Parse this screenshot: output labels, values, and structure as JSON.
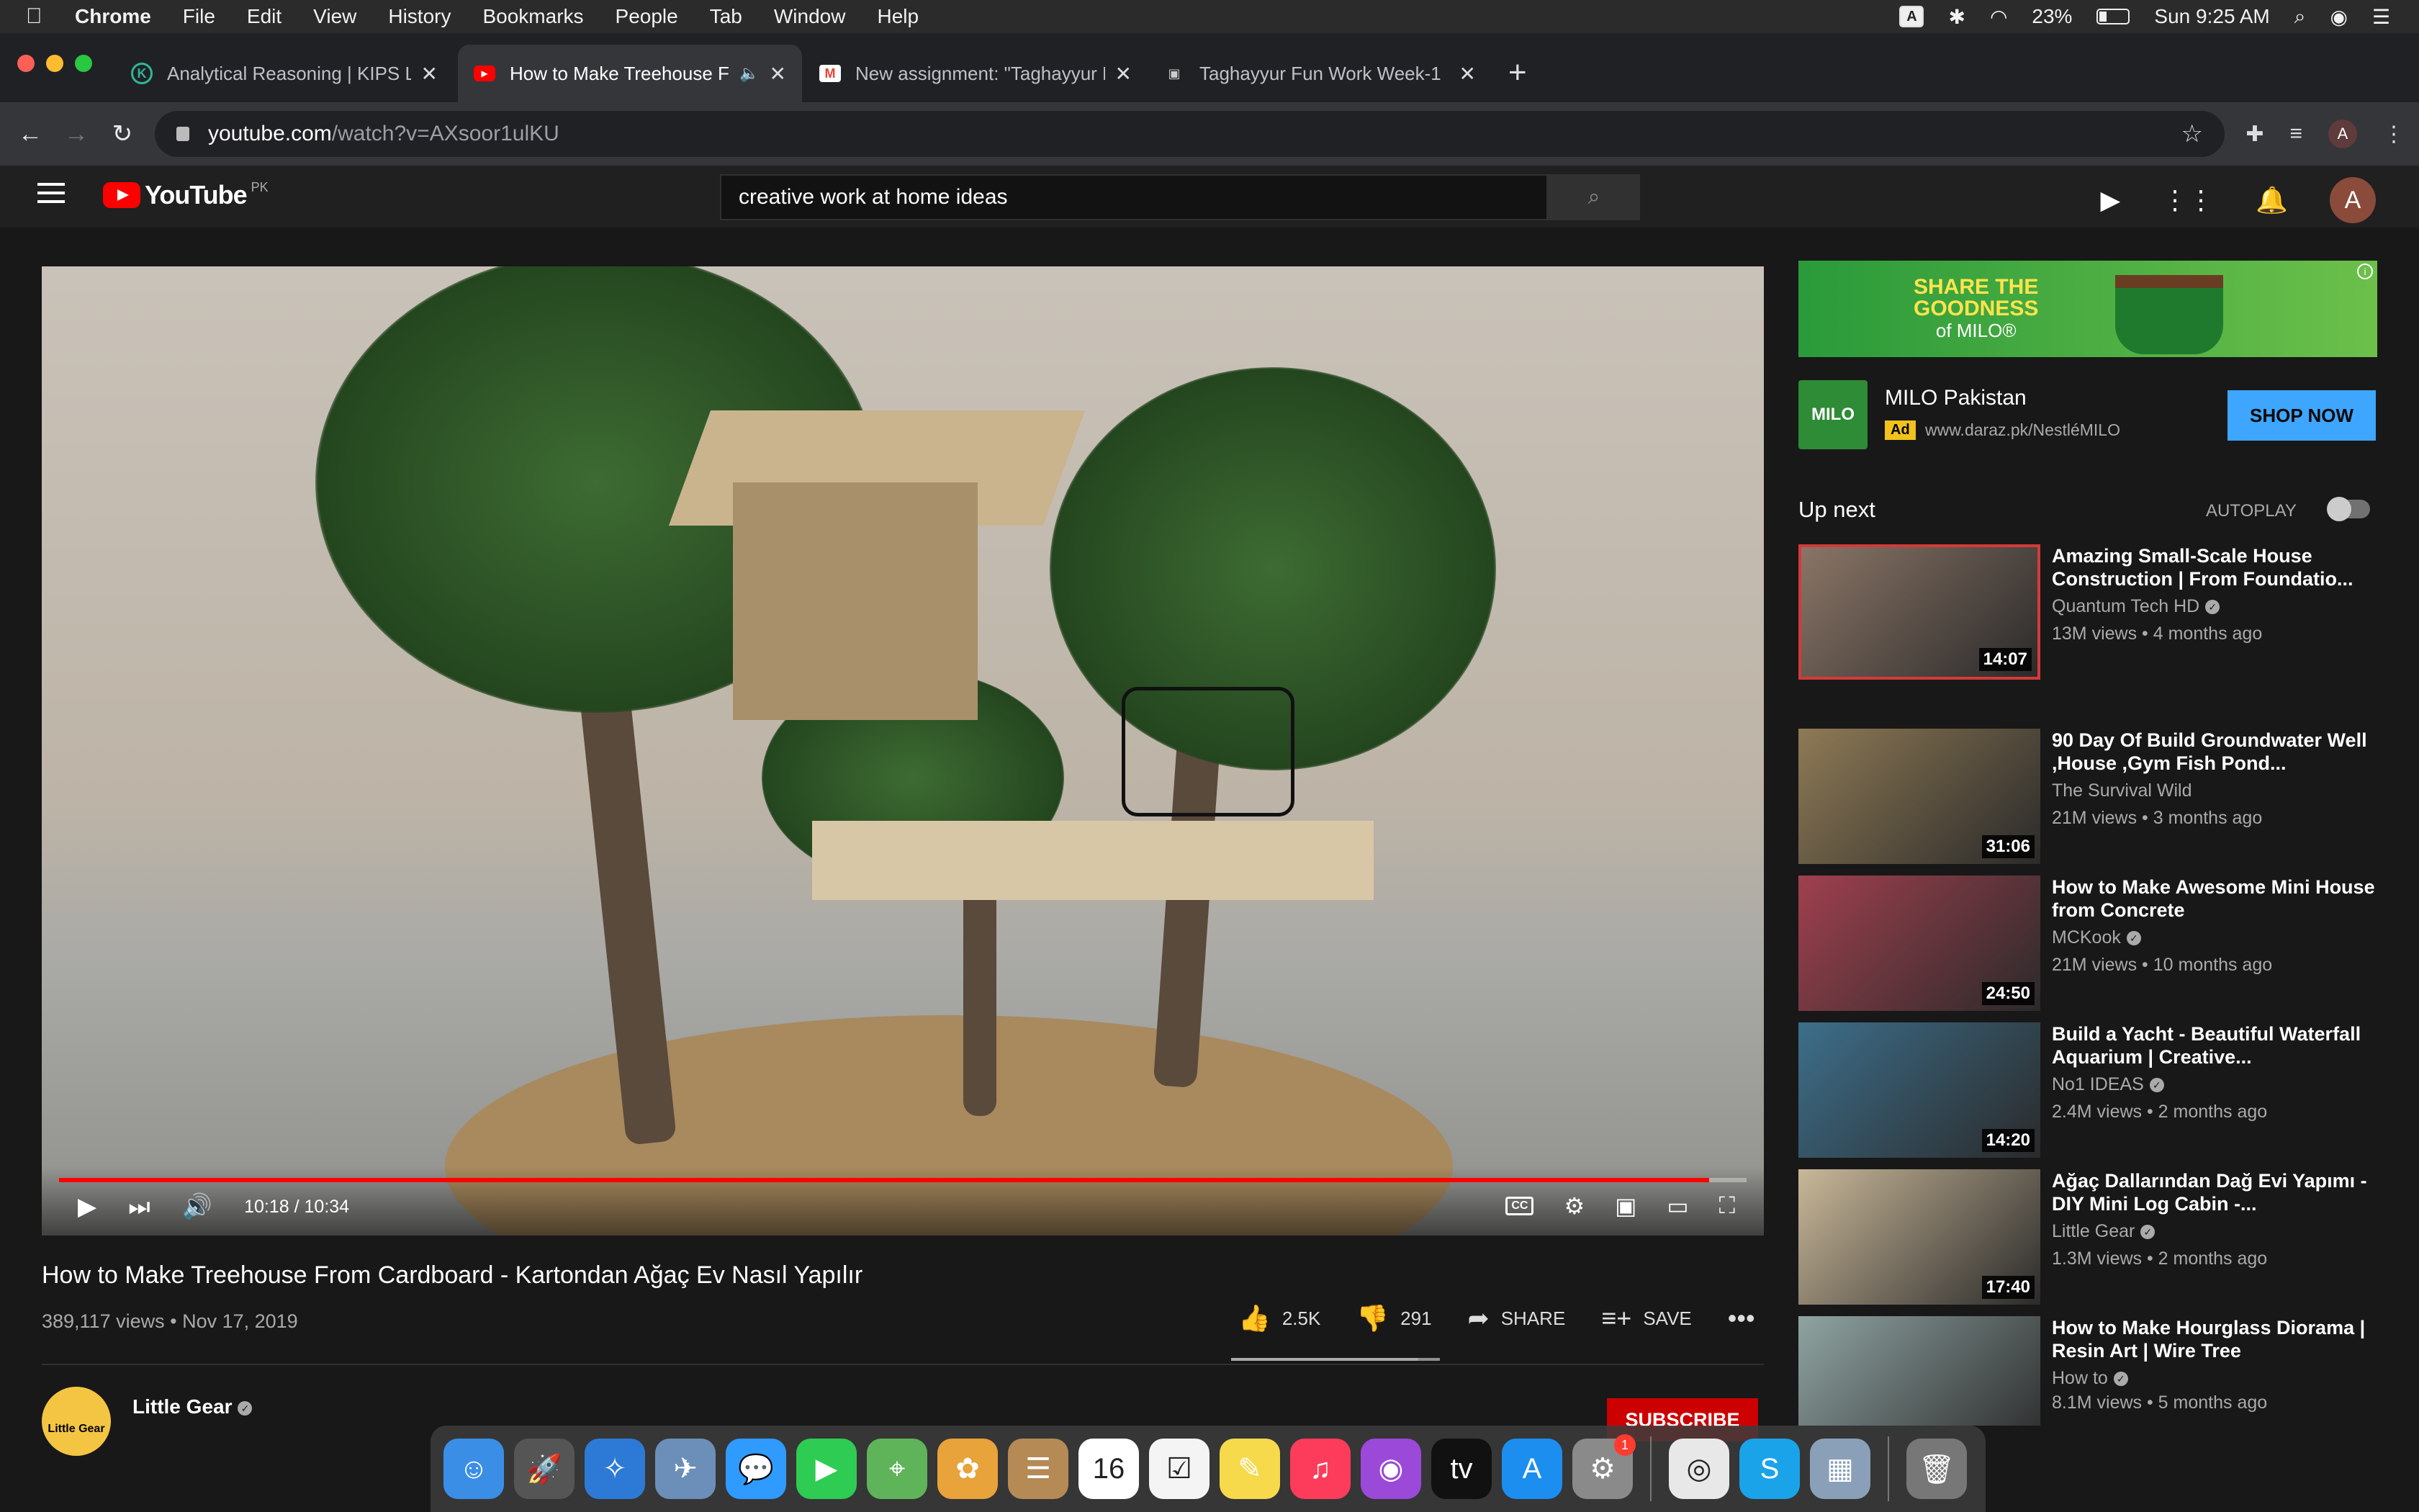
{
  "menubar": {
    "app": "Chrome",
    "items": [
      "File",
      "Edit",
      "View",
      "History",
      "Bookmarks",
      "People",
      "Tab",
      "Window",
      "Help"
    ],
    "input_source": "A",
    "battery": "23%",
    "clock": "Sun 9:25 AM"
  },
  "tabs": [
    {
      "title": "Analytical Reasoning | KIPS LM",
      "favicon": "K",
      "color": "#2fb59b"
    },
    {
      "title": "How to Make Treehouse Fr",
      "favicon": "▶",
      "color": "#ff0000"
    },
    {
      "title": "New assignment: \"Taghayyur F",
      "favicon": "M",
      "color": "#ea4335"
    },
    {
      "title": "Taghayyur Fun Work Week-1",
      "favicon": "▣",
      "color": "#888888"
    }
  ],
  "address": {
    "host": "youtube.com",
    "path": "/watch?v=AXsoor1ulKU"
  },
  "profile_initial": "A",
  "youtube": {
    "region": "PK",
    "search_query": "creative work at home ideas",
    "avatar_initial": "A"
  },
  "player": {
    "time": "10:18 / 10:34",
    "progress": 0.978
  },
  "video": {
    "title": "How to Make Treehouse From Cardboard - Kartondan Ağaç Ev Nasıl Yapılır",
    "meta": "389,117 views • Nov 17, 2019",
    "likes": "2.5K",
    "dislikes": "291",
    "share": "SHARE",
    "save": "SAVE",
    "like_ratio": 0.896
  },
  "channel": {
    "name": "Little Gear",
    "avatar_text": "Little Gear",
    "subscribe": "SUBSCRIBE"
  },
  "ad": {
    "banner_lines": [
      "SHARE THE",
      "GOODNESS",
      "of MILO®"
    ],
    "advertiser": "MILO Pakistan",
    "badge": "Ad",
    "url": "www.daraz.pk/NestléMILO",
    "cta": "SHOP NOW",
    "logo_text": "MILO"
  },
  "sidebar": {
    "up_next": "Up next",
    "autoplay": "AUTOPLAY",
    "videos": [
      {
        "title": "Amazing Small-Scale House Construction | From Foundatio...",
        "channel": "Quantum Tech HD",
        "stats": "13M views • 4 months ago",
        "duration": "14:07",
        "thumb": "#8a7566"
      },
      {
        "title": "90 Day Of Build Groundwater Well ,House ,Gym Fish Pond...",
        "channel": "The Survival Wild",
        "stats": "21M views • 3 months ago",
        "duration": "31:06",
        "thumb": "#8e7a55"
      },
      {
        "title": "How to Make Awesome Mini House from Concrete",
        "channel": "MCKook",
        "stats": "21M views • 10 months ago",
        "duration": "24:50",
        "thumb": "#a0404e"
      },
      {
        "title": "Build a Yacht - Beautiful Waterfall Aquarium | Creative...",
        "channel": "No1 IDEAS",
        "stats": "2.4M views • 2 months ago",
        "duration": "14:20",
        "thumb": "#3d6e8a"
      },
      {
        "title": "Ağaç Dallarından Dağ Evi Yapımı - DIY Mini Log Cabin -...",
        "channel": "Little Gear",
        "stats": "1.3M views • 2 months ago",
        "duration": "17:40",
        "thumb": "#c9b899"
      },
      {
        "title": "How to Make Hourglass Diorama | Resin Art | Wire Tree",
        "channel": "How to",
        "stats": "8.1M views • 5 months ago",
        "duration": "",
        "thumb": "#8fa4a2"
      }
    ]
  },
  "dock": [
    {
      "name": "finder",
      "glyph": "☺",
      "color": "#3a8ee6"
    },
    {
      "name": "launchpad",
      "glyph": "🚀",
      "color": "#555"
    },
    {
      "name": "safari",
      "glyph": "✧",
      "color": "#2d7ad6"
    },
    {
      "name": "preview",
      "glyph": "✈",
      "color": "#6b8fb8"
    },
    {
      "name": "messages",
      "glyph": "💬",
      "color": "#2f9bff"
    },
    {
      "name": "facetime",
      "glyph": "▶",
      "color": "#2ecc52"
    },
    {
      "name": "maps",
      "glyph": "⌖",
      "color": "#5fb45a"
    },
    {
      "name": "photos",
      "glyph": "✿",
      "color": "#e8a33a"
    },
    {
      "name": "contacts",
      "glyph": "☰",
      "color": "#b58a55"
    },
    {
      "name": "calendar",
      "glyph": "16",
      "color": "#ffffff"
    },
    {
      "name": "reminders",
      "glyph": "☑",
      "color": "#f4f4f4"
    },
    {
      "name": "notes",
      "glyph": "✎",
      "color": "#f7d94c"
    },
    {
      "name": "music",
      "glyph": "♫",
      "color": "#fc3c5a"
    },
    {
      "name": "podcasts",
      "glyph": "◉",
      "color": "#9b49d9"
    },
    {
      "name": "tv",
      "glyph": "tv",
      "color": "#111"
    },
    {
      "name": "app-store",
      "glyph": "A",
      "color": "#1b8ef0"
    },
    {
      "name": "system-preferences",
      "glyph": "⚙",
      "color": "#8a8a8a",
      "badge": "1"
    },
    {
      "name": "chrome",
      "glyph": "◎",
      "color": "#e8e8e8"
    },
    {
      "name": "skype",
      "glyph": "S",
      "color": "#1aa3e8"
    },
    {
      "name": "image-capture",
      "glyph": "▦",
      "color": "#8aa0b8"
    },
    {
      "name": "trash",
      "glyph": "🗑",
      "color": "#777"
    }
  ],
  "colors": {
    "youtube_red": "#ff0000",
    "subscribe_red": "#cc0000",
    "cta_blue": "#3ea6ff"
  }
}
